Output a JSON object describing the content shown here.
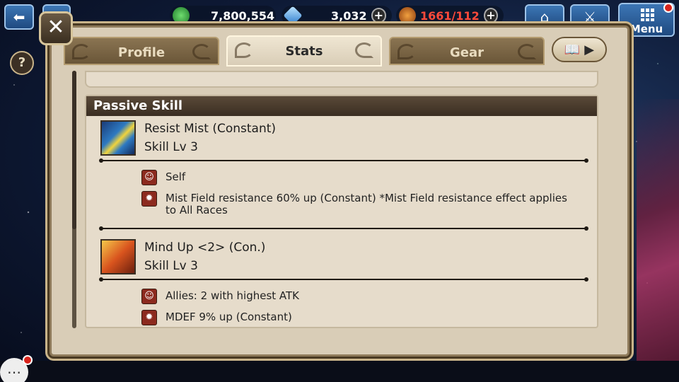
{
  "topbar": {
    "gems": "7,800,554",
    "crystals": "3,032",
    "stamina": "1661/112",
    "menu_label": "Menu"
  },
  "panel": {
    "tabs": [
      {
        "label": "Profile",
        "active": false
      },
      {
        "label": "Stats",
        "active": true
      },
      {
        "label": "Gear",
        "active": false
      }
    ],
    "section_title": "Passive Skill",
    "skills": [
      {
        "name": "Resist Mist (Constant)",
        "level": "Skill Lv 3",
        "icon": "resist-mist-icon",
        "target": "Self",
        "effect": "Mist Field resistance 60% up   (Constant)   *Mist Field resistance effect applies to All Races"
      },
      {
        "name": "Mind Up <2> (Con.)",
        "level": "Skill Lv 3",
        "icon": "mind-up-icon",
        "target": "Allies: 2 with highest ATK",
        "effect": "MDEF 9% up   (Constant)"
      }
    ]
  },
  "colors": {
    "panel_bg": "#d9cdb7",
    "header_bg": "#3a2e22",
    "accent_red": "#d9241c"
  }
}
